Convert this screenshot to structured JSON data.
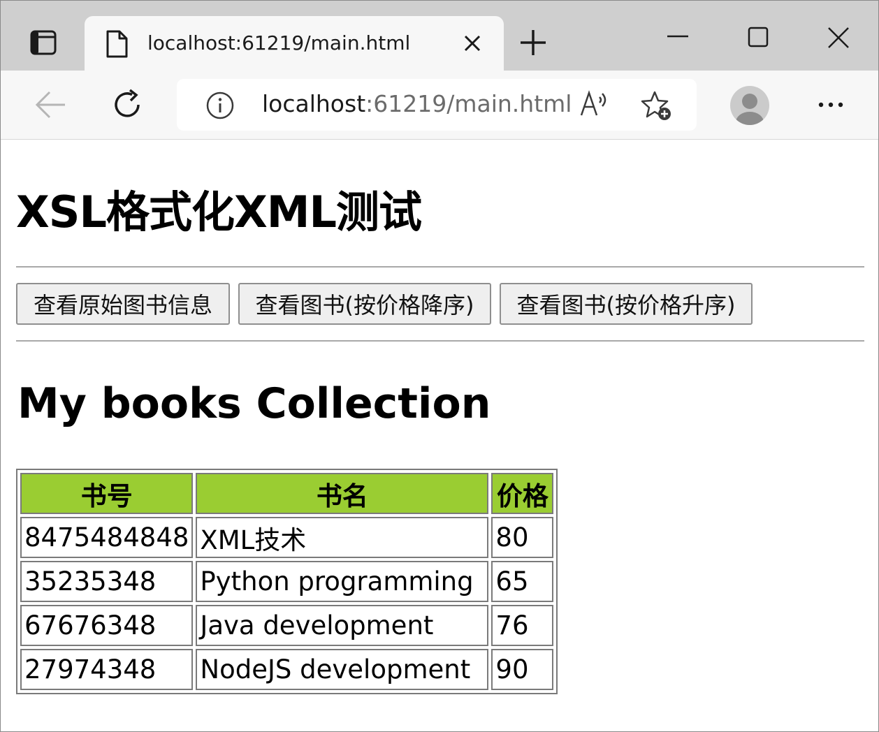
{
  "browser": {
    "tab": {
      "title": "localhost:61219/main.html"
    },
    "address": {
      "host": "localhost",
      "rest": ":61219/main.html"
    }
  },
  "page": {
    "title": "XSL格式化XML测试",
    "buttons": [
      {
        "label": "查看原始图书信息"
      },
      {
        "label": "查看图书(按价格降序)"
      },
      {
        "label": "查看图书(按价格升序)"
      }
    ],
    "section_title": "My books Collection",
    "table": {
      "headers": [
        "书号",
        "书名",
        "价格"
      ],
      "rows": [
        [
          "8475484848",
          "XML技术",
          "80"
        ],
        [
          "35235348",
          "Python programming",
          "65"
        ],
        [
          "67676348",
          "Java development",
          "76"
        ],
        [
          "27974348",
          "NodeJS development",
          "90"
        ]
      ]
    }
  },
  "colors": {
    "header_bg": "#9acd32",
    "tabstrip_bg": "#cfcfcf",
    "toolbar_bg": "#f7f7f7"
  },
  "icons": [
    "tab-actions-icon",
    "page-icon",
    "close-tab-icon",
    "new-tab-icon",
    "minimize-icon",
    "maximize-icon",
    "window-close-icon",
    "back-icon",
    "reload-icon",
    "info-icon",
    "read-aloud-icon",
    "add-favorite-icon",
    "profile-avatar-icon",
    "more-icon"
  ]
}
